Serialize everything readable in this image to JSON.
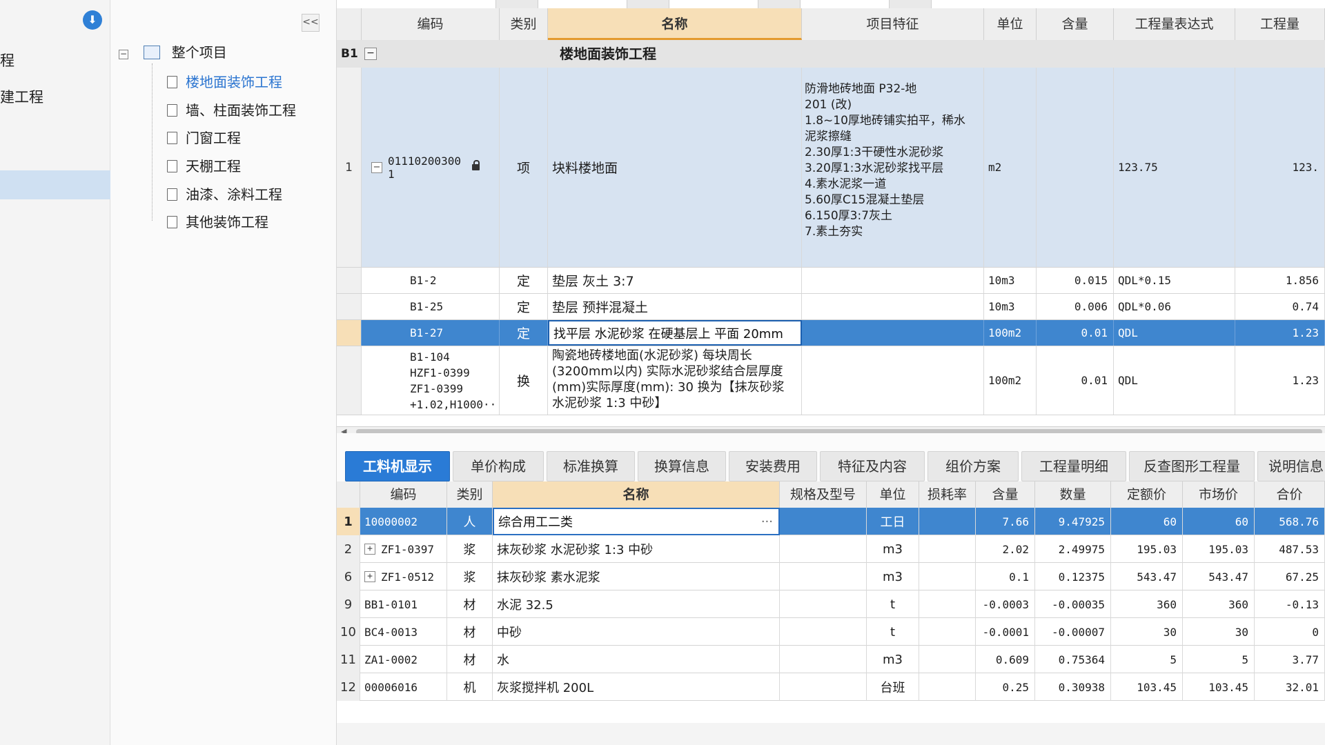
{
  "left_strip": {
    "items": [
      {
        "label": "程"
      },
      {
        "label": "建工程"
      }
    ]
  },
  "tree": {
    "collapse_icon": "double-chevron-left-icon",
    "root": {
      "label": "整个项目"
    },
    "children": [
      {
        "label": "楼地面装饰工程",
        "active": true
      },
      {
        "label": "墙、柱面装饰工程"
      },
      {
        "label": "门窗工程"
      },
      {
        "label": "天棚工程"
      },
      {
        "label": "油漆、涂料工程"
      },
      {
        "label": "其他装饰工程"
      }
    ]
  },
  "upper_grid": {
    "headers": {
      "code": "编码",
      "type": "类别",
      "name": "名称",
      "feature": "项目特征",
      "unit": "单位",
      "content": "含量",
      "expr": "工程量表达式",
      "qty": "工程量"
    },
    "group": {
      "id": "B1",
      "title": "楼地面装饰工程"
    },
    "rows": [
      {
        "num": "1",
        "code": "01110200300\n1",
        "type": "项",
        "name": "块料楼地面",
        "feature": "防滑地砖地面 P32-地\n201 (改)\n1.8~10厚地砖铺实拍平，稀水\n泥浆擦缝\n2.30厚1:3干硬性水泥砂浆\n3.20厚1:3水泥砂浆找平层\n4.素水泥浆一道\n5.60厚C15混凝土垫层\n6.150厚3:7灰土\n7.素土夯实",
        "unit": "m2",
        "content": "",
        "expr": "123.75",
        "qty": "123."
      },
      {
        "num": "",
        "code": "B1-2",
        "type": "定",
        "name": "垫层 灰土 3:7",
        "unit": "10m3",
        "content": "0.015",
        "expr": "QDL*0.15",
        "qty": "1.856"
      },
      {
        "num": "",
        "code": "B1-25",
        "type": "定",
        "name": "垫层 预拌混凝土",
        "unit": "10m3",
        "content": "0.006",
        "expr": "QDL*0.06",
        "qty": "0.74"
      },
      {
        "num": "",
        "code": "B1-27",
        "type": "定",
        "name": "找平层 水泥砂浆 在硬基层上 平面 20mm",
        "unit": "100m2",
        "content": "0.01",
        "expr": "QDL",
        "qty": "1.23",
        "selected": true
      },
      {
        "num": "",
        "code": "B1-104\nHZF1-0399\nZF1-0399\n+1.02,H1000···",
        "type": "换",
        "name": "陶瓷地砖楼地面(水泥砂浆) 每块周长\n(3200mm以内) 实际水泥砂浆结合层厚度\n(mm)实际厚度(mm): 30 换为【抹灰砂浆\n水泥砂浆 1:3 中砂】",
        "unit": "100m2",
        "content": "0.01",
        "expr": "QDL",
        "qty": "1.23"
      }
    ]
  },
  "lower_tabs": [
    {
      "label": "工料机显示",
      "active": true
    },
    {
      "label": "单价构成"
    },
    {
      "label": "标准换算"
    },
    {
      "label": "换算信息"
    },
    {
      "label": "安装费用"
    },
    {
      "label": "特征及内容"
    },
    {
      "label": "组价方案"
    },
    {
      "label": "工程量明细"
    },
    {
      "label": "反查图形工程量"
    },
    {
      "label": "说明信息"
    }
  ],
  "lower_grid": {
    "headers": {
      "code": "编码",
      "type": "类别",
      "name": "名称",
      "spec": "规格及型号",
      "unit": "单位",
      "loss": "损耗率",
      "content": "含量",
      "qty": "数量",
      "quota": "定额价",
      "market": "市场价",
      "total": "合价"
    },
    "rows": [
      {
        "idx": "1",
        "code": "10000002",
        "type": "人",
        "name": "综合用工二类",
        "spec": "",
        "unit": "工日",
        "loss": "",
        "content": "7.66",
        "qty": "9.47925",
        "quota": "60",
        "market": "60",
        "total": "568.76",
        "selected": true
      },
      {
        "idx": "2",
        "code": "ZF1-0397",
        "expand": true,
        "type": "浆",
        "name": "抹灰砂浆 水泥砂浆 1:3 中砂",
        "spec": "",
        "unit": "m3",
        "loss": "",
        "content": "2.02",
        "qty": "2.49975",
        "quota": "195.03",
        "market": "195.03",
        "total": "487.53"
      },
      {
        "idx": "6",
        "code": "ZF1-0512",
        "expand": true,
        "type": "浆",
        "name": "抹灰砂浆 素水泥浆",
        "spec": "",
        "unit": "m3",
        "loss": "",
        "content": "0.1",
        "qty": "0.12375",
        "quota": "543.47",
        "market": "543.47",
        "total": "67.25"
      },
      {
        "idx": "9",
        "code": "BB1-0101",
        "type": "材",
        "name": "水泥 32.5",
        "spec": "",
        "unit": "t",
        "loss": "",
        "content": "-0.0003",
        "qty": "-0.00035",
        "quota": "360",
        "market": "360",
        "total": "-0.13"
      },
      {
        "idx": "10",
        "code": "BC4-0013",
        "type": "材",
        "name": "中砂",
        "spec": "",
        "unit": "t",
        "loss": "",
        "content": "-0.0001",
        "qty": "-0.00007",
        "quota": "30",
        "market": "30",
        "total": "0"
      },
      {
        "idx": "11",
        "code": "ZA1-0002",
        "type": "材",
        "name": "水",
        "spec": "",
        "unit": "m3",
        "loss": "",
        "content": "0.609",
        "qty": "0.75364",
        "quota": "5",
        "market": "5",
        "total": "3.77"
      },
      {
        "idx": "12",
        "code": "00006016",
        "type": "机",
        "name": "灰浆搅拌机 200L",
        "spec": "",
        "unit": "台班",
        "loss": "",
        "content": "0.25",
        "qty": "0.30938",
        "quota": "103.45",
        "market": "103.45",
        "total": "32.01"
      }
    ]
  },
  "colors": {
    "accent": "#2a7bd6",
    "selected_row": "#3f86cf",
    "header_highlight": "#f7dfb7"
  }
}
